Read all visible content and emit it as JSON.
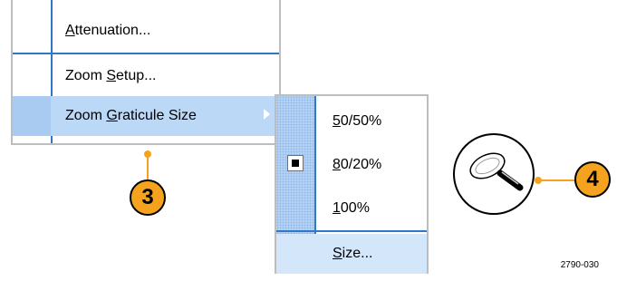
{
  "menu": {
    "items": [
      {
        "label": "Attenuation...",
        "mnemonic": "A"
      },
      {
        "label": "Zoom Setup...",
        "mnemonic": "S"
      },
      {
        "label": "Zoom Graticule Size",
        "mnemonic": "G"
      }
    ]
  },
  "submenu": {
    "items": [
      {
        "label": "50/50%",
        "checked": false
      },
      {
        "label": "80/20%",
        "checked": true
      },
      {
        "label": "100%",
        "checked": false
      },
      {
        "label": "Size...",
        "checked": false
      }
    ]
  },
  "callouts": {
    "step3": "3",
    "step4": "4"
  },
  "figure_id": "2790-030",
  "colors": {
    "accent_line": "#2f78c8",
    "highlight": "#bcd8f7",
    "callout": "#f5a31e"
  },
  "icons": {
    "zoom": "magnifier-icon",
    "submenu_arrow": "chevron-right-icon",
    "check": "checkmark-box-icon"
  }
}
